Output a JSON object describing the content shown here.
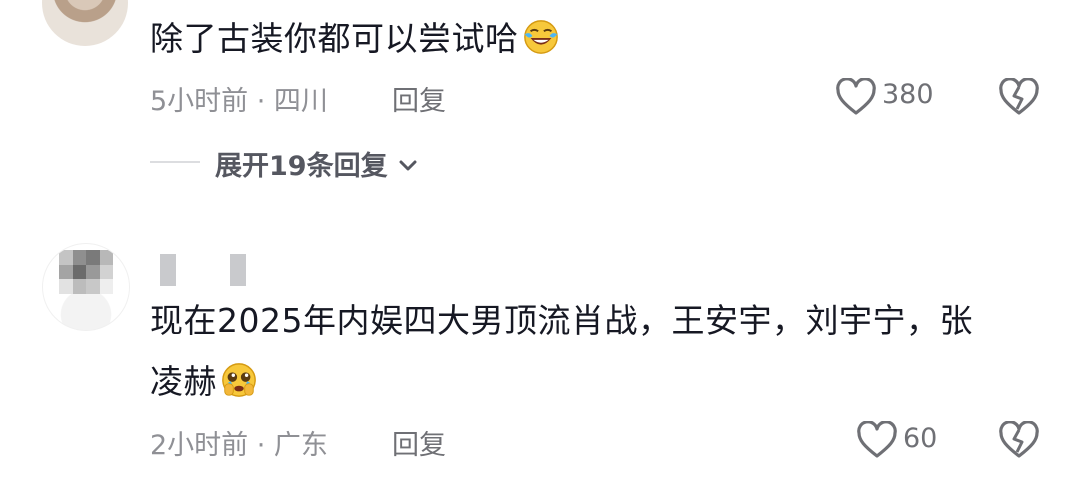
{
  "comments": [
    {
      "text": "除了古装你都可以尝试哈",
      "emoji": "laughing-crying-emoji",
      "time_location": "5小时前 · 四川",
      "reply_label": "回复",
      "like_count": "380",
      "expand_label": "展开19条回复"
    },
    {
      "text_line1": "现在2025年内娱四大男顶流肖战，王安宇，刘宇宁，张",
      "text_line2": "凌赫",
      "emoji": "pleading-face-emoji",
      "time_location": "2小时前 · 广东",
      "reply_label": "回复",
      "like_count": "60"
    }
  ],
  "icons": {
    "like": "heart-outline-icon",
    "dislike": "broken-heart-icon",
    "expand": "chevron-down-icon"
  },
  "colors": {
    "text": "#161823",
    "meta": "#8f9095",
    "icon": "#6f7075"
  }
}
